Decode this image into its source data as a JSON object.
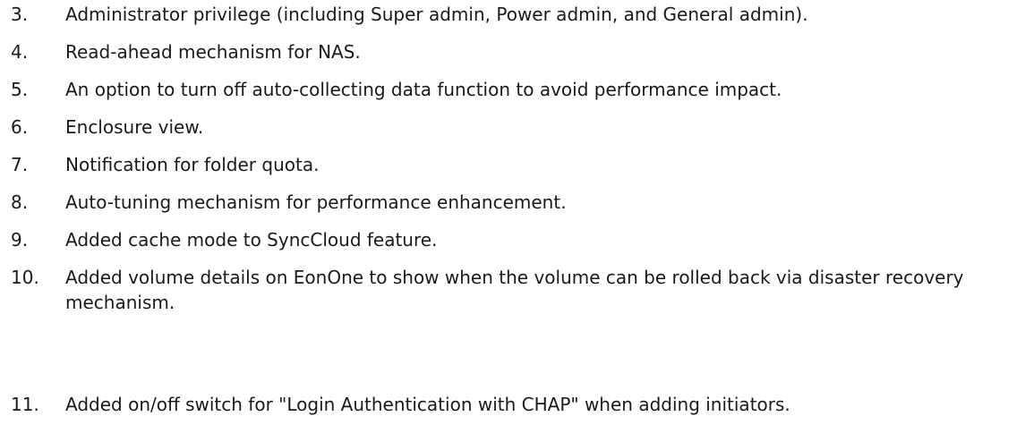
{
  "items": [
    {
      "number": "3.",
      "text": "Administrator privilege (including Super admin, Power admin, and General admin)."
    },
    {
      "number": "4.",
      "text": "Read-ahead mechanism for NAS."
    },
    {
      "number": "5.",
      "text": "An option to turn off auto-collecting data function to avoid performance impact."
    },
    {
      "number": "6.",
      "text": "Enclosure view."
    },
    {
      "number": "7.",
      "text": "Notification for folder quota."
    },
    {
      "number": "8.",
      "text": "Auto-tuning mechanism for performance enhancement."
    },
    {
      "number": "9.",
      "text": "Added cache mode to SyncCloud feature."
    },
    {
      "number": "10.",
      "text": "Added volume details on EonOne to show when the volume can be rolled back via disaster recovery mechanism."
    },
    {
      "number": "11.",
      "text": "Added on/off switch for \"Login Authentication with CHAP\" when adding initiators."
    }
  ]
}
